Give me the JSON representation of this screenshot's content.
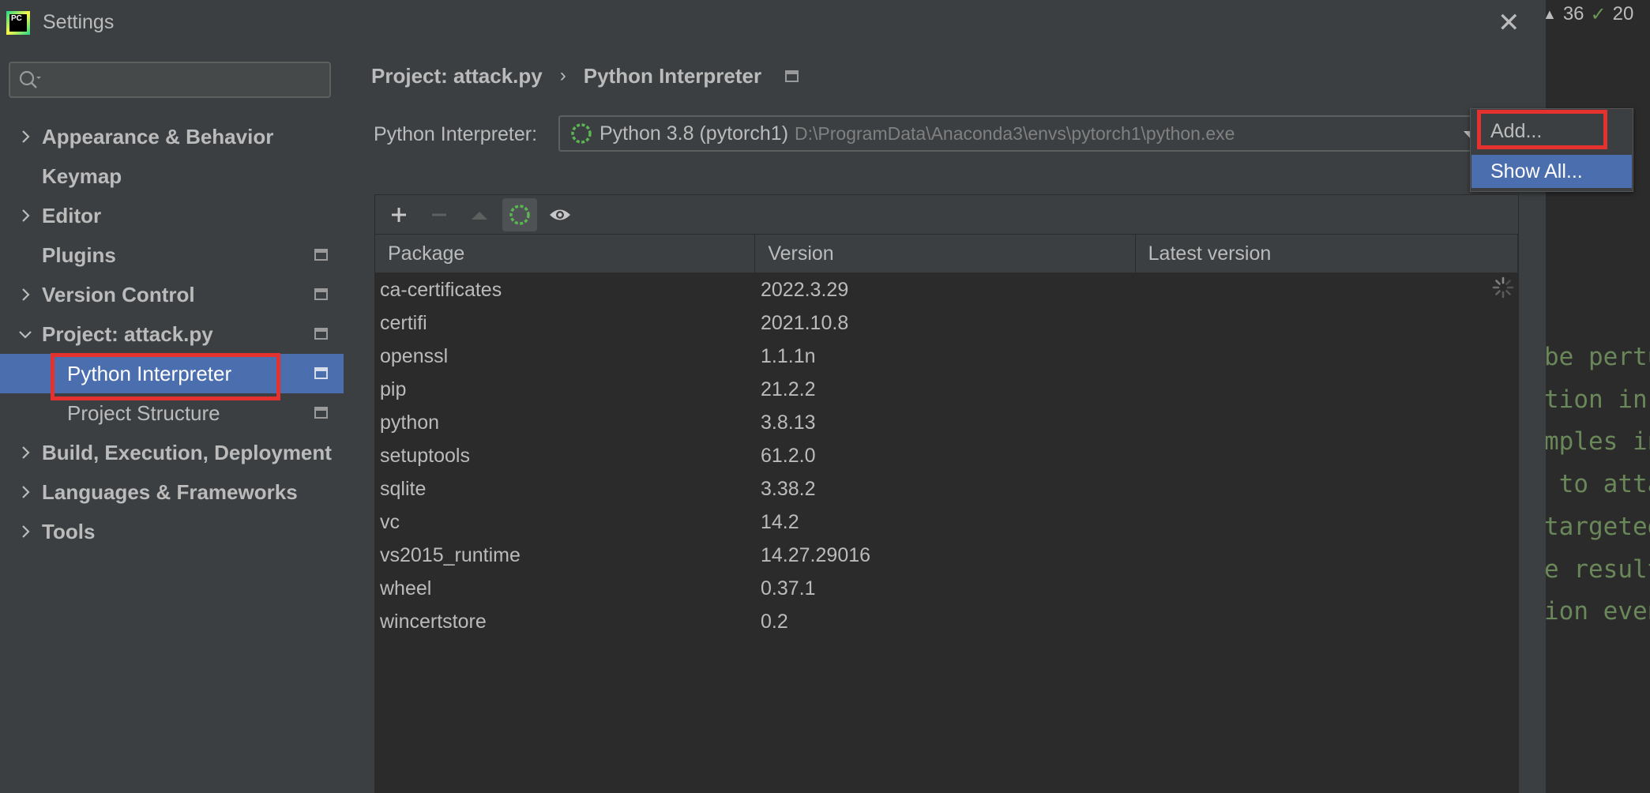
{
  "window": {
    "title": "Settings",
    "logo_text": "PC",
    "close_glyph": "✕"
  },
  "editor_background": {
    "status_warnings": "36",
    "status_checks": "20",
    "code_lines": [
      "be pertu",
      "tion in",
      "mples in",
      " to atta",
      "targeted",
      "e result",
      "ion even"
    ]
  },
  "sidebar": {
    "search_placeholder": "",
    "items": [
      {
        "label": "Appearance & Behavior",
        "bold": true,
        "expandable": true,
        "expanded": false,
        "level": 1,
        "project_icon": false
      },
      {
        "label": "Keymap",
        "bold": true,
        "expandable": false,
        "level": 1,
        "project_icon": false
      },
      {
        "label": "Editor",
        "bold": true,
        "expandable": true,
        "expanded": false,
        "level": 1,
        "project_icon": false
      },
      {
        "label": "Plugins",
        "bold": true,
        "expandable": false,
        "level": 1,
        "project_icon": true
      },
      {
        "label": "Version Control",
        "bold": true,
        "expandable": true,
        "expanded": false,
        "level": 1,
        "project_icon": true
      },
      {
        "label": "Project: attack.py",
        "bold": true,
        "expandable": true,
        "expanded": true,
        "level": 1,
        "project_icon": true
      },
      {
        "label": "Python Interpreter",
        "bold": false,
        "expandable": false,
        "level": 2,
        "project_icon": true,
        "selected": true
      },
      {
        "label": "Project Structure",
        "bold": false,
        "expandable": false,
        "level": 2,
        "project_icon": true
      },
      {
        "label": "Build, Execution, Deployment",
        "bold": true,
        "expandable": true,
        "expanded": false,
        "level": 1,
        "project_icon": false
      },
      {
        "label": "Languages & Frameworks",
        "bold": true,
        "expandable": true,
        "expanded": false,
        "level": 1,
        "project_icon": false
      },
      {
        "label": "Tools",
        "bold": true,
        "expandable": true,
        "expanded": false,
        "level": 1,
        "project_icon": false
      }
    ]
  },
  "breadcrumb": {
    "parent": "Project: attack.py",
    "separator": "›",
    "current": "Python Interpreter"
  },
  "interpreter": {
    "label": "Python Interpreter:",
    "name": "Python 3.8 (pytorch1)",
    "path": "D:\\ProgramData\\Anaconda3\\envs\\pytorch1\\python.exe"
  },
  "gear_menu": {
    "add_label": "Add...",
    "show_all_label": "Show All..."
  },
  "toolbar": {
    "install_icon": "plus-icon",
    "uninstall_icon": "minus-icon",
    "upgrade_icon": "triangle-up-icon",
    "conda_icon": "conda-refresh-icon",
    "show_early_icon": "eye-icon"
  },
  "packages": {
    "columns": [
      "Package",
      "Version",
      "Latest version"
    ],
    "rows": [
      {
        "name": "ca-certificates",
        "version": "2022.3.29",
        "latest": ""
      },
      {
        "name": "certifi",
        "version": "2021.10.8",
        "latest": ""
      },
      {
        "name": "openssl",
        "version": "1.1.1n",
        "latest": ""
      },
      {
        "name": "pip",
        "version": "21.2.2",
        "latest": ""
      },
      {
        "name": "python",
        "version": "3.8.13",
        "latest": ""
      },
      {
        "name": "setuptools",
        "version": "61.2.0",
        "latest": ""
      },
      {
        "name": "sqlite",
        "version": "3.38.2",
        "latest": ""
      },
      {
        "name": "vc",
        "version": "14.2",
        "latest": ""
      },
      {
        "name": "vs2015_runtime",
        "version": "14.27.29016",
        "latest": ""
      },
      {
        "name": "wheel",
        "version": "0.37.1",
        "latest": ""
      },
      {
        "name": "wincertstore",
        "version": "0.2",
        "latest": ""
      }
    ]
  },
  "colors": {
    "accent_selection": "#4b6eaf",
    "highlight_box": "#e5322f",
    "conda_green": "#5bb552",
    "code_green": "#6a8759"
  }
}
